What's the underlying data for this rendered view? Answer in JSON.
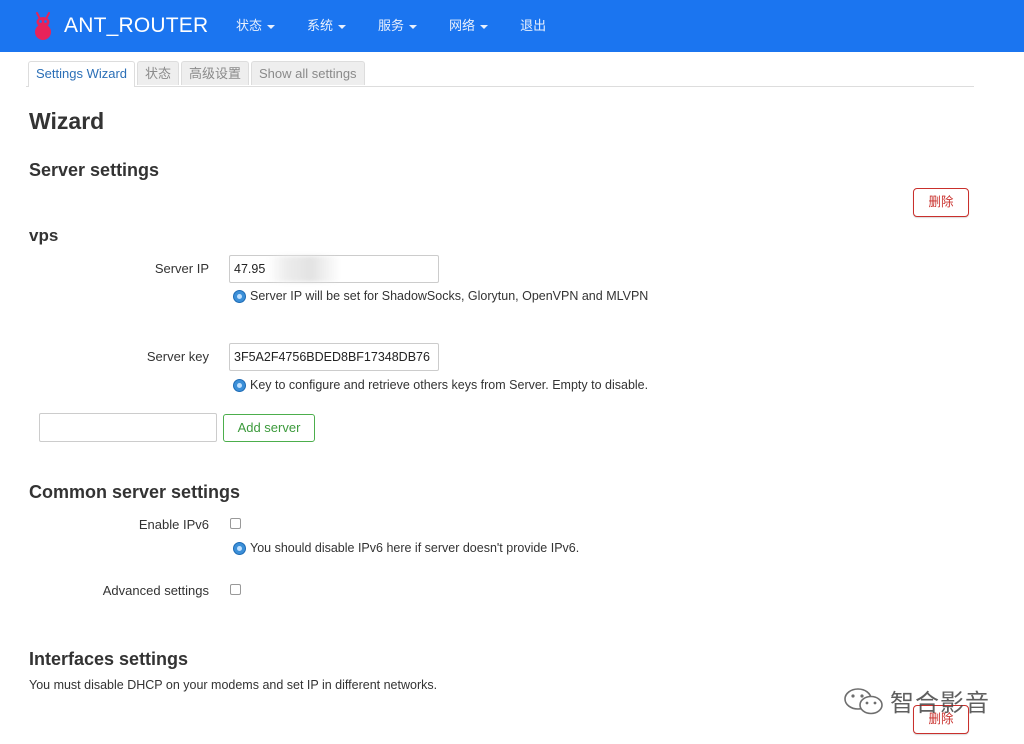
{
  "navbar": {
    "brand": "ANT_ROUTER",
    "menu": [
      {
        "label": "状态",
        "has_caret": true
      },
      {
        "label": "系统",
        "has_caret": true
      },
      {
        "label": "服务",
        "has_caret": true
      },
      {
        "label": "网络",
        "has_caret": true
      },
      {
        "label": "退出",
        "has_caret": false
      }
    ],
    "color": "#1b75f0"
  },
  "tabs": [
    {
      "label": "Settings Wizard",
      "active": true
    },
    {
      "label": "状态",
      "active": false
    },
    {
      "label": "高级设置",
      "active": false
    },
    {
      "label": "Show all settings",
      "active": false
    }
  ],
  "page": {
    "title": "Wizard",
    "server_settings": {
      "heading": "Server settings",
      "delete_label": "删除",
      "section_name": "vps",
      "server_ip": {
        "label": "Server IP",
        "value": "47.95",
        "help": "Server IP will be set for ShadowSocks, Glorytun, OpenVPN and MLVPN"
      },
      "server_key": {
        "label": "Server key",
        "value": "3F5A2F4756BDED8BF17348DB76",
        "help": "Key to configure and retrieve others keys from Server. Empty to disable."
      },
      "new_server_value": "",
      "add_server_label": "Add server"
    },
    "common_settings": {
      "heading": "Common server settings",
      "enable_ipv6": {
        "label": "Enable IPv6",
        "checked": false,
        "help": "You should disable IPv6 here if server doesn't provide IPv6."
      },
      "advanced": {
        "label": "Advanced settings",
        "checked": false
      }
    },
    "interfaces_settings": {
      "heading": "Interfaces settings",
      "note": "You must disable DHCP on your modems and set IP in different networks.",
      "delete_label": "删除"
    }
  },
  "watermark": {
    "text": "智合影音"
  },
  "colors": {
    "danger": "#c9302c",
    "success": "#4cae4c",
    "link": "#2b6fb7"
  }
}
